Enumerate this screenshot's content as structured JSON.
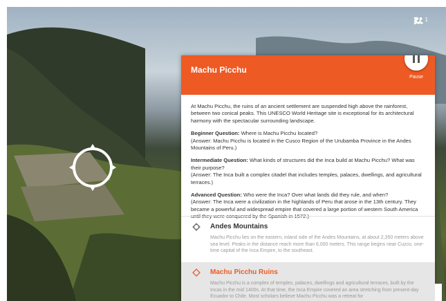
{
  "topbar": {
    "icon_translate": "translate-icon",
    "icon_people": "people-icon",
    "people_count": "1",
    "icon_more": "more-vert-icon"
  },
  "panel": {
    "title": "Machu Picchu",
    "pause_label": "Pause",
    "intro": "At Machu Picchu, the ruins of an ancient settlement are suspended high above the rainforest, between two conical peaks. This UNESCO World Heritage site is exceptional for its architectural harmony with the spectacular surrounding landscape.",
    "questions": [
      {
        "label": "Beginner Question:",
        "question": " Where is Machu Picchu located?",
        "answer": "(Answer: Machu Picchu is located in the Cusco Region of the Urubamba Province in the Andes Mountains of Peru.)"
      },
      {
        "label": "Intermediate Question:",
        "question": " What kinds of structures did the Inca build at Machu Picchu? What was their purpose?",
        "answer": "(Answer: The Inca built a complex citadel that includes temples, palaces, dwellings, and agricultural terraces.)"
      },
      {
        "label": "Advanced Question:",
        "question": " Who were the Inca? Over what lands did they rule, and when?",
        "answer": "(Answer: The Inca were a civilization in the highlands of Peru that arose in the 13th century. They became a powerful and widespread empire that covered a large portion of western South America until they were conquered by the Spanish in 1572.)"
      }
    ]
  },
  "points": [
    {
      "title": "Andes Mountains",
      "description": "Machu Picchu lies on the eastern, inland side of the Andes Mountains, at about 2,350 meters above sea level. Peaks in the distance reach more than 6,000 meters. This range begins near Cuzco, one-time capital of the Inca Empire, to the southeast.",
      "icon": "circle-point-icon"
    },
    {
      "title": "Machu Picchu Ruins",
      "description": "Machu Picchu is a complex of temples, palaces, dwellings and agricultural terraces, built by the Incas in the mid 1400s. At that time, the Inca Empire covered an area stretching from present-day Ecuador to Chile. Most scholars believe Machu Picchu was a retreat for",
      "icon": "diamond-point-icon"
    }
  ],
  "colors": {
    "accent": "#ee5a24",
    "selected_bg": "#e6e6e6"
  }
}
